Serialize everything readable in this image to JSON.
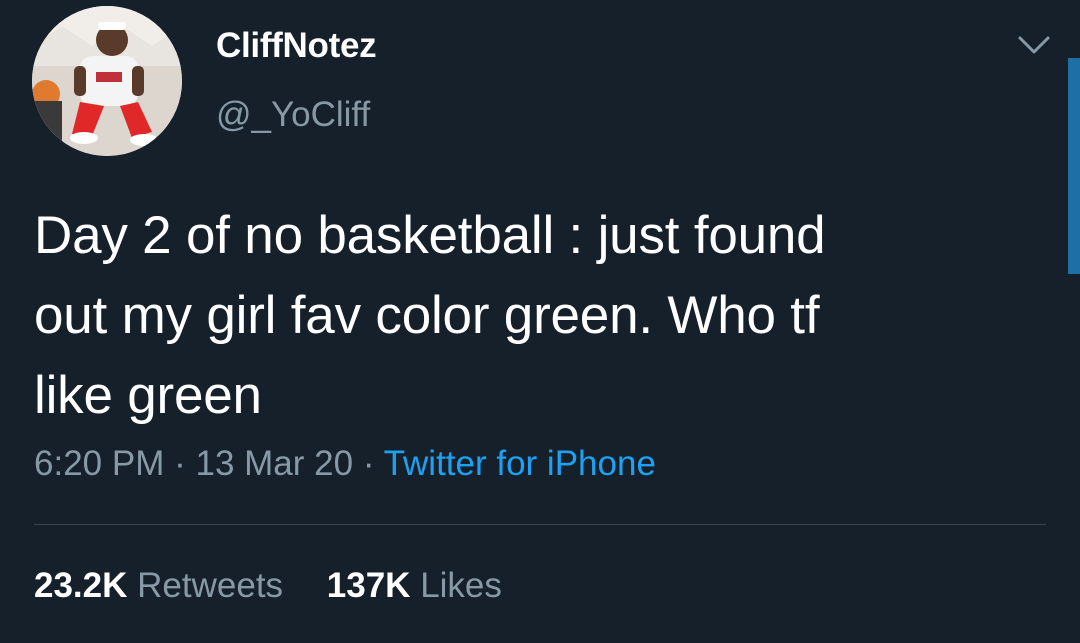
{
  "tweet": {
    "author": {
      "display_name": "CliffNotez",
      "handle": "@_YoCliff"
    },
    "text": "Day 2 of no basketball : just found\nout my girl fav color green. Who tf\nlike green",
    "time": "6:20 PM",
    "date": "13 Mar 20",
    "separator": "·",
    "source": "Twitter for iPhone",
    "stats": {
      "retweets_count": "23.2K",
      "retweets_label": "Retweets",
      "likes_count": "137K",
      "likes_label": "Likes"
    }
  },
  "colors": {
    "background": "#15202b",
    "secondary_text": "#8899a6",
    "link": "#1da1f2",
    "divider": "#38444d"
  },
  "icons": {
    "menu": "chevron-down-icon"
  }
}
